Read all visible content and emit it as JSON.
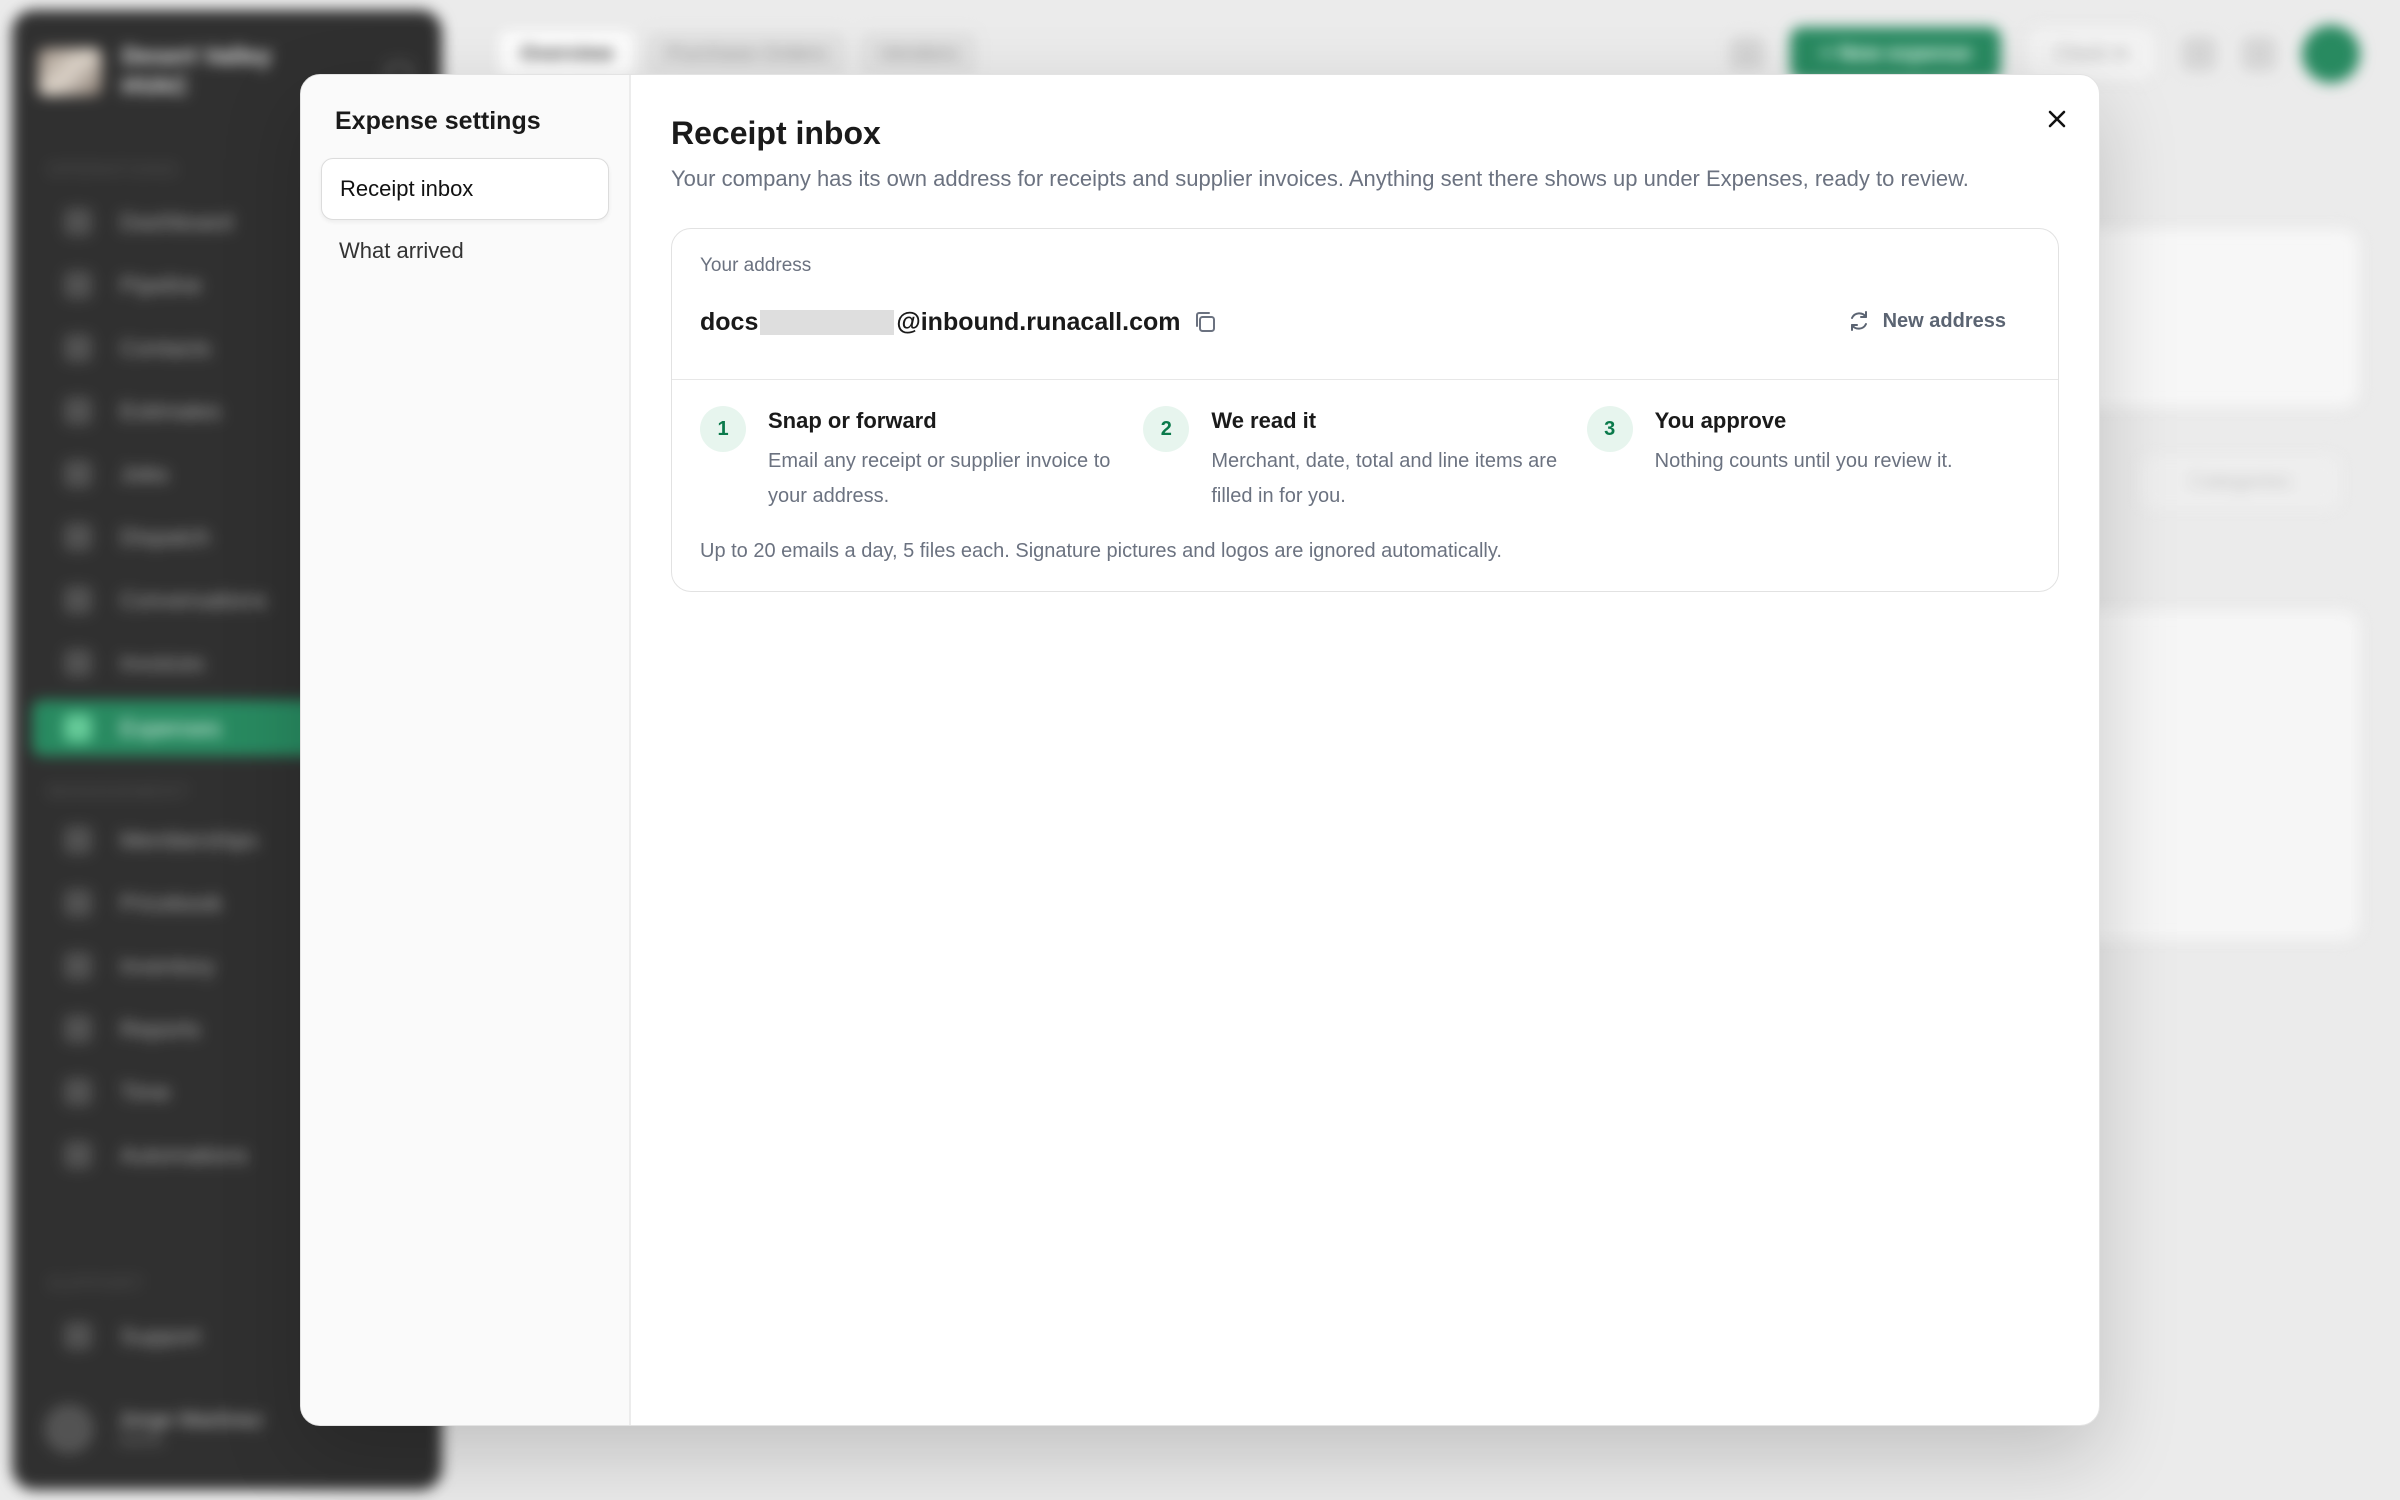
{
  "background": {
    "brand_name": "Desert Valley HVAC",
    "sections": [
      "OPERATIONS",
      "MANAGEMENT",
      "SUPPORT"
    ],
    "nav_items": [
      "Dashboard",
      "Pipeline",
      "Contacts",
      "Estimates",
      "Jobs",
      "Dispatch",
      "Conversations",
      "Invoices",
      "Expenses",
      "Memberships",
      "Pricebook",
      "Inventory",
      "Reports",
      "Time",
      "Automations",
      "Support"
    ],
    "active_nav": "Expenses",
    "tabs": [
      "Overview",
      "Purchase Orders",
      "Vendors"
    ],
    "new_button": "+ New expense",
    "clock_button": "Clock in",
    "user_name": "Jorge Martinez",
    "user_role": "Admin",
    "categories_button": "Categories",
    "accent_color": "#0b7a4b"
  },
  "modal": {
    "title": "Expense settings",
    "nav": [
      {
        "label": "Receipt inbox",
        "active": true
      },
      {
        "label": "What arrived",
        "active": false
      }
    ],
    "main": {
      "title": "Receipt inbox",
      "description": "Your company has its own address for receipts and supplier invoices. Anything sent there shows up under Expenses, ready to review.",
      "address_label": "Your address",
      "address_prefix": "docs",
      "address_domain": "@inbound.runacall.com",
      "new_address_label": "New address",
      "steps": [
        {
          "num": "1",
          "title": "Snap or forward",
          "desc": "Email any receipt or supplier invoice to your address."
        },
        {
          "num": "2",
          "title": "We read it",
          "desc": "Merchant, date, total and line items are filled in for you."
        },
        {
          "num": "3",
          "title": "You approve",
          "desc": "Nothing counts until you review it."
        }
      ],
      "note": "Up to 20 emails a day, 5 files each. Signature pictures and logos are ignored automatically."
    },
    "icons": {
      "close": "close-icon",
      "copy": "copy-icon",
      "refresh": "refresh-icon"
    }
  }
}
